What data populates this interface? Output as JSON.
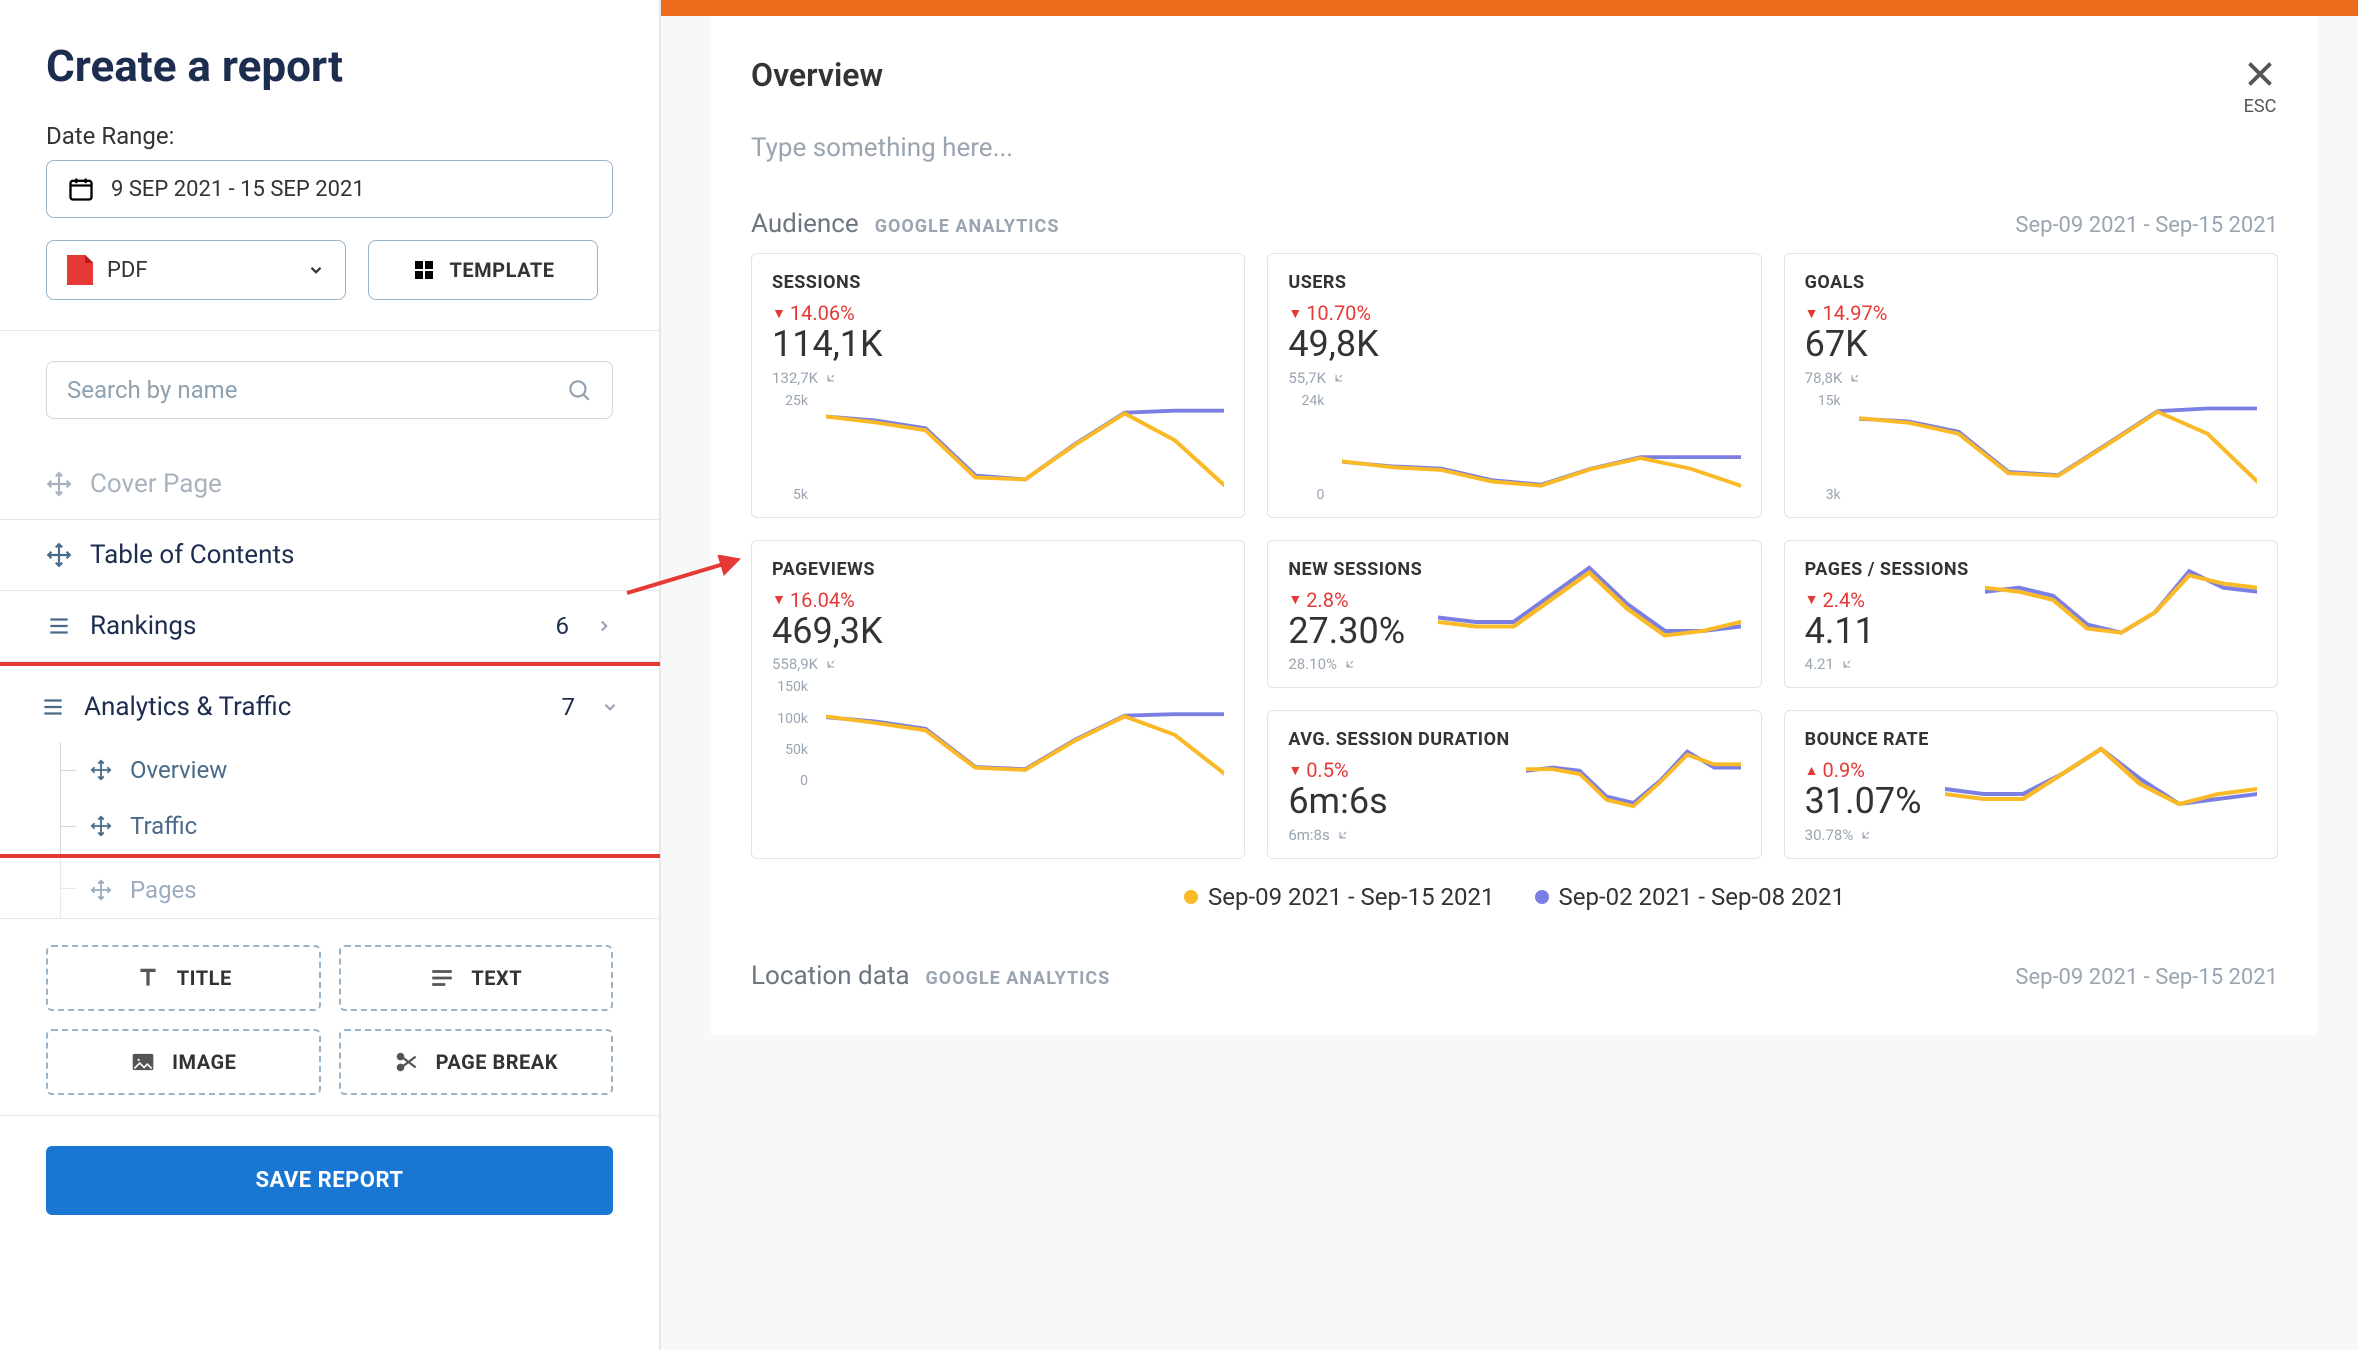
{
  "sidebar": {
    "title": "Create a report",
    "date_label": "Date Range:",
    "date_value": "9 SEP 2021 - 15 SEP 2021",
    "format_label": "PDF",
    "template_label": "TEMPLATE",
    "search_placeholder": "Search by name",
    "cover_label": "Cover Page",
    "toc_label": "Table of Contents",
    "rankings_label": "Rankings",
    "rankings_count": "6",
    "analytics_label": "Analytics & Traffic",
    "analytics_count": "7",
    "sub_overview": "Overview",
    "sub_traffic": "Traffic",
    "sub_pages": "Pages",
    "btn_title": "TITLE",
    "btn_text": "TEXT",
    "btn_image": "IMAGE",
    "btn_pagebreak": "PAGE BREAK",
    "save": "SAVE REPORT"
  },
  "preview": {
    "title": "Overview",
    "hint": "Type something here...",
    "esc": "ESC",
    "section1_title": "Audience",
    "section1_source": "GOOGLE ANALYTICS",
    "section1_range": "Sep-09 2021 - Sep-15 2021",
    "section2_title": "Location data",
    "section2_source": "GOOGLE ANALYTICS",
    "section2_range": "Sep-09 2021 - Sep-15 2021",
    "legend1": "Sep-09 2021 - Sep-15 2021",
    "legend2": "Sep-02 2021 - Sep-08 2021"
  },
  "chart_data": [
    {
      "id": "sessions",
      "type": "line",
      "title": "SESSIONS",
      "delta": {
        "dir": "down",
        "text": "14.06%"
      },
      "value": "114,1K",
      "prev": "132,7K",
      "yticks": [
        "25k",
        "5k"
      ],
      "ylim": [
        0,
        28000
      ],
      "series": [
        {
          "name": "Sep-02 2021 - Sep-08 2021",
          "color": "#7b7fe3",
          "values": [
            22000,
            21000,
            19000,
            7000,
            6000,
            15000,
            23000,
            23500,
            23500
          ]
        },
        {
          "name": "Sep-09 2021 - Sep-15 2021",
          "color": "#fab926",
          "values": [
            22000,
            20500,
            18500,
            6500,
            6000,
            14800,
            22800,
            16000,
            4500
          ]
        }
      ]
    },
    {
      "id": "users",
      "type": "line",
      "title": "USERS",
      "delta": {
        "dir": "down",
        "text": "10.70%"
      },
      "value": "49,8K",
      "prev": "55,7K",
      "yticks": [
        "24k",
        "0"
      ],
      "ylim": [
        0,
        24000
      ],
      "series": [
        {
          "name": "prev",
          "color": "#7b7fe3",
          "values": [
            9000,
            8000,
            7500,
            5000,
            4000,
            7500,
            10000,
            10000,
            10000
          ]
        },
        {
          "name": "curr",
          "color": "#fab926",
          "values": [
            9100,
            7800,
            7200,
            4700,
            3800,
            7400,
            9800,
            7500,
            3800
          ]
        }
      ]
    },
    {
      "id": "goals",
      "type": "line",
      "title": "GOALS",
      "delta": {
        "dir": "down",
        "text": "14.97%"
      },
      "value": "67K",
      "prev": "78,8K",
      "yticks": [
        "15k",
        "3k"
      ],
      "ylim": [
        0,
        17000
      ],
      "series": [
        {
          "name": "prev",
          "color": "#7b7fe3",
          "values": [
            13000,
            12600,
            11000,
            4800,
            4300,
            9200,
            14200,
            14600,
            14600
          ]
        },
        {
          "name": "curr",
          "color": "#fab926",
          "values": [
            13100,
            12400,
            10700,
            4600,
            4200,
            9100,
            14100,
            10700,
            3300
          ]
        }
      ]
    },
    {
      "id": "pageviews",
      "type": "line",
      "title": "PAGEVIEWS",
      "delta": {
        "dir": "down",
        "text": "16.04%"
      },
      "value": "469,3K",
      "prev": "558,9K",
      "yticks": [
        "150k",
        "100k",
        "50k",
        "0"
      ],
      "ylim": [
        0,
        150000
      ],
      "series": [
        {
          "name": "prev",
          "color": "#7b7fe3",
          "values": [
            98000,
            92000,
            82000,
            30000,
            27000,
            67000,
            100000,
            102000,
            102000
          ]
        },
        {
          "name": "curr",
          "color": "#fab926",
          "values": [
            99000,
            90000,
            80000,
            29000,
            26000,
            66000,
            99000,
            74000,
            21000
          ]
        }
      ]
    },
    {
      "id": "newsessions",
      "type": "line",
      "title": "NEW SESSIONS",
      "delta": {
        "dir": "down",
        "text": "2.8%"
      },
      "value": "27.30%",
      "prev": "28.10%",
      "yticks": [],
      "ylim": [
        20,
        40
      ],
      "series": [
        {
          "name": "prev",
          "color": "#7b7fe3",
          "values": [
            27,
            26,
            26,
            32,
            38,
            30,
            24,
            24,
            25
          ]
        },
        {
          "name": "curr",
          "color": "#fab926",
          "values": [
            26,
            25,
            25,
            31,
            37,
            29,
            23,
            24,
            26
          ]
        }
      ]
    },
    {
      "id": "pps",
      "type": "line",
      "title": "PAGES / SESSIONS",
      "delta": {
        "dir": "down",
        "text": "2.4%"
      },
      "value": "4.11",
      "prev": "4.21",
      "yticks": [],
      "ylim": [
        3.0,
        5.2
      ],
      "series": [
        {
          "name": "prev",
          "color": "#7b7fe3",
          "values": [
            4.4,
            4.5,
            4.3,
            3.6,
            3.4,
            3.9,
            4.9,
            4.5,
            4.4
          ]
        },
        {
          "name": "curr",
          "color": "#fab926",
          "values": [
            4.5,
            4.4,
            4.2,
            3.5,
            3.4,
            3.9,
            4.8,
            4.6,
            4.5
          ]
        }
      ]
    },
    {
      "id": "avgdur",
      "type": "line",
      "title": "AVG. SESSION DURATION",
      "delta": {
        "dir": "down",
        "text": "0.5%"
      },
      "value": "6m:6s",
      "prev": "6m:8s",
      "yticks": [],
      "ylim": [
        240,
        520
      ],
      "series": [
        {
          "name": "prev",
          "color": "#7b7fe3",
          "values": [
            390,
            400,
            390,
            310,
            290,
            360,
            450,
            400,
            400
          ]
        },
        {
          "name": "curr",
          "color": "#fab926",
          "values": [
            395,
            395,
            380,
            300,
            280,
            355,
            440,
            410,
            410
          ]
        }
      ]
    },
    {
      "id": "bounce",
      "type": "line",
      "title": "BOUNCE RATE",
      "delta": {
        "dir": "up",
        "text": "0.9%"
      },
      "value": "31.07%",
      "prev": "30.78%",
      "yticks": [],
      "ylim": [
        24,
        42
      ],
      "series": [
        {
          "name": "prev",
          "color": "#7b7fe3",
          "values": [
            30,
            29,
            29,
            33,
            38,
            32,
            27,
            28,
            29
          ]
        },
        {
          "name": "curr",
          "color": "#fab926",
          "values": [
            29,
            28,
            28,
            33,
            38,
            31,
            27,
            29,
            30
          ]
        }
      ]
    }
  ]
}
